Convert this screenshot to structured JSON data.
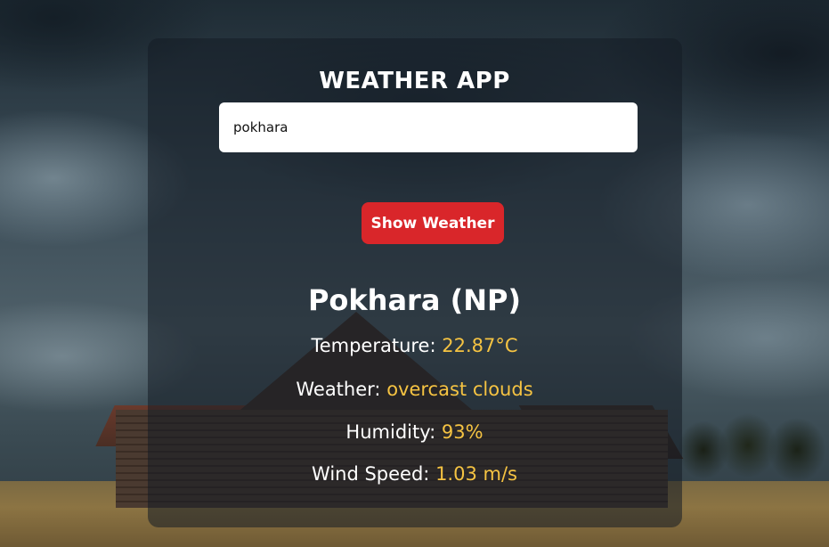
{
  "app": {
    "title": "WEATHER APP"
  },
  "search": {
    "value": "pokhara"
  },
  "actions": {
    "show_weather_label": "Show Weather"
  },
  "result": {
    "location": "Pokhara (NP)",
    "temperature": {
      "label": "Temperature:",
      "value": "22.87°C"
    },
    "weather": {
      "label": "Weather:",
      "value": "overcast clouds"
    },
    "humidity": {
      "label": "Humidity:",
      "value": "93%"
    },
    "wind_speed": {
      "label": "Wind Speed:",
      "value": "1.03 m/s"
    }
  },
  "colors": {
    "button": "#d9262a",
    "value_accent": "#f5c342",
    "text": "#ffffff"
  }
}
